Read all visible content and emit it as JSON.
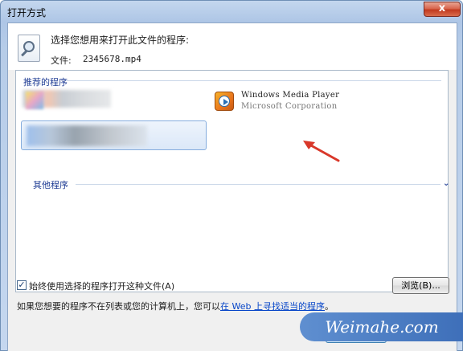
{
  "window": {
    "title": "打开方式",
    "close_glyph": "x"
  },
  "header": {
    "prompt": "选择您想用来打开此文件的程序:",
    "file_label": "文件:",
    "file_name": "2345678.mp4"
  },
  "programs": {
    "recommended_label": "推荐的程序",
    "other_label": "其他程序",
    "other_chevron": "⌄",
    "wmp": {
      "name": "Windows Media Player",
      "company": "Microsoft Corporation",
      "icon": "windows-media-player-icon"
    }
  },
  "options": {
    "always_use_label": "始终使用选择的程序打开这种文件(A)",
    "always_use_checked": true,
    "browse_label": "浏览(B)..."
  },
  "footer": {
    "prefix": "如果您想要的程序不在列表或您的计算机上，您可以",
    "link": "在 Web 上寻找适当的程序",
    "suffix": "。"
  },
  "watermark": {
    "text": "Weimahe.com"
  },
  "colors": {
    "annotation_arrow": "#d9382a",
    "section_label": "#1f3c94",
    "link": "#0645c8"
  }
}
